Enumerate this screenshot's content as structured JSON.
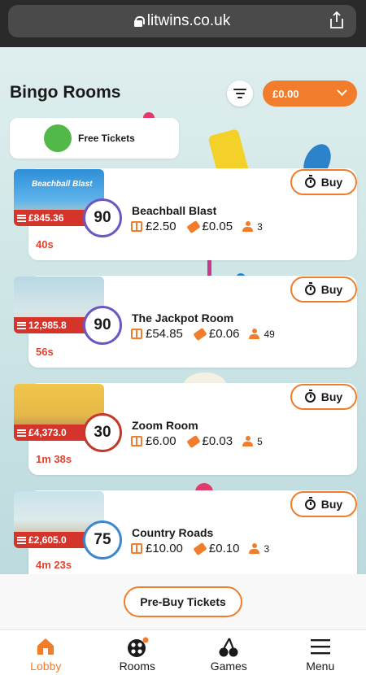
{
  "browser": {
    "url": "litwins.co.uk"
  },
  "header": {
    "title": "Bingo Rooms",
    "balance": "£0.00"
  },
  "free_tickets": {
    "label": "Free Tickets"
  },
  "rooms": [
    {
      "name": "Beachball Blast",
      "jackpot": "£845.36",
      "ball": "90",
      "prize": "£2.50",
      "ticket_price": "£0.05",
      "players": "3",
      "timer": "40s",
      "buy_label": "Buy",
      "thumb_text": "Beachball Blast"
    },
    {
      "name": "The Jackpot Room",
      "jackpot": "12,985.8",
      "ball": "90",
      "prize": "£54.85",
      "ticket_price": "£0.06",
      "players": "49",
      "timer": "56s",
      "buy_label": "Buy"
    },
    {
      "name": "Zoom Room",
      "jackpot": "£4,373.0",
      "ball": "30",
      "prize": "£6.00",
      "ticket_price": "£0.03",
      "players": "5",
      "timer": "1m 38s",
      "buy_label": "Buy"
    },
    {
      "name": "Country Roads",
      "jackpot": "£2,605.0",
      "ball": "75",
      "prize": "£10.00",
      "ticket_price": "£0.10",
      "players": "3",
      "timer": "4m 23s",
      "buy_label": "Buy"
    }
  ],
  "prebuy": {
    "label": "Pre-Buy Tickets"
  },
  "nav": [
    {
      "label": "Lobby",
      "icon": "home-icon",
      "active": true
    },
    {
      "label": "Rooms",
      "icon": "bingo-balls-icon",
      "active": false
    },
    {
      "label": "Games",
      "icon": "cherries-icon",
      "active": false
    },
    {
      "label": "Menu",
      "icon": "hamburger-icon",
      "active": false
    }
  ],
  "colors": {
    "accent": "#f07c2c",
    "jackpot": "#d5342b",
    "timer": "#e0432e",
    "green": "#52b848"
  }
}
